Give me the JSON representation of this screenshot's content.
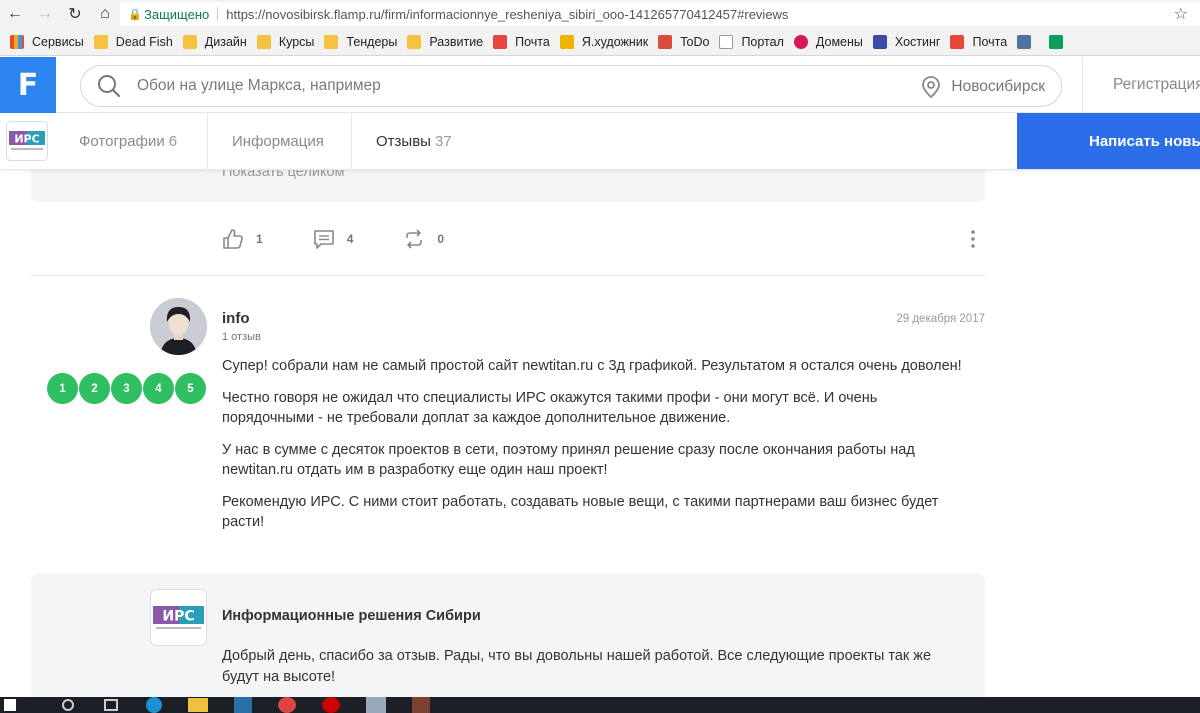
{
  "browser": {
    "secure_label": "Защищено",
    "url": "https://novosibirsk.flamp.ru/firm/informacionnye_resheniya_sibiri_ooo-141265770412457#reviews",
    "bookmarks": [
      "Сервисы",
      "Dead Fish",
      "Дизайн",
      "Курсы",
      "Тендеры",
      "Развитие",
      "Почта",
      "Я.художник",
      "ToDo",
      "Портал",
      "Домены",
      "Хостинг",
      "Почта"
    ]
  },
  "header": {
    "logo_letter": "F",
    "search_placeholder": "Обои на улице Маркса, например",
    "city": "Новосибирск",
    "register": "Регистрация"
  },
  "firm_logo_text": "ИРС",
  "tabs": [
    {
      "label": "Фотографии",
      "count": "6"
    },
    {
      "label": "Информация",
      "count": ""
    },
    {
      "label": "Отзывы",
      "count": "37"
    }
  ],
  "write_button": "Написать новый отзыв",
  "previous_review": {
    "show_full": "Показать целиком",
    "likes": "1",
    "comments": "4",
    "reposts": "0"
  },
  "review": {
    "author": "info",
    "author_reviews": "1 отзыв",
    "date": "29 декабря 2017",
    "rating": 5,
    "rating_labels": [
      "1",
      "2",
      "3",
      "4",
      "5"
    ],
    "paragraphs": [
      "Супер! собрали нам не самый простой сайт newtitan.ru с 3д графикой. Результатом я остался очень доволен!",
      "Честно говоря не ожидал что специалисты ИРС окажутся такими профи - они могут всё. И очень порядочными - не требовали доплат за каждое дополнительное движение.",
      "У нас в сумме с десяток проектов в сети, поэтому принял решение сразу после окончания работы над newtitan.ru отдать им в разработку еще один наш проект!",
      "Рекомендую ИРС. С ними стоит работать, создавать новые вещи, с такими партнерами ваш бизнес будет расти!"
    ]
  },
  "reply": {
    "company": "Информационные решения Сибири",
    "text": "Добрый день, спасибо за отзыв. Рады, что вы довольны нашей работой. Все следующие проекты так же будут на высоте!"
  },
  "colors": {
    "brand_blue": "#2b84f0",
    "button_blue": "#2b6ee8",
    "rating_green": "#2fbf62"
  }
}
